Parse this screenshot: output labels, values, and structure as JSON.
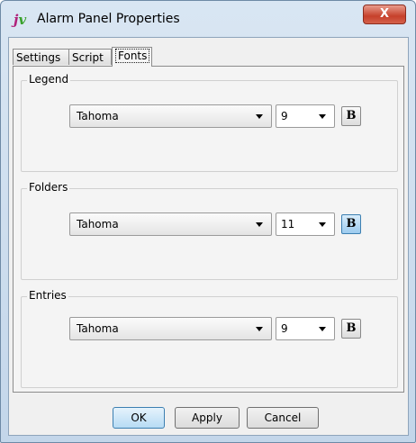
{
  "window": {
    "title": "Alarm Panel Properties",
    "close_label": "X"
  },
  "tabs": [
    {
      "label": "Settings",
      "active": false
    },
    {
      "label": "Script",
      "active": false
    },
    {
      "label": "Fonts",
      "active": true
    }
  ],
  "groups": {
    "legend": {
      "title": "Legend",
      "font": "Tahoma",
      "size": "9",
      "bold_label": "B",
      "bold_active": false
    },
    "folders": {
      "title": "Folders",
      "font": "Tahoma",
      "size": "11",
      "bold_label": "B",
      "bold_active": true
    },
    "entries": {
      "title": "Entries",
      "font": "Tahoma",
      "size": "9",
      "bold_label": "B",
      "bold_active": false
    }
  },
  "buttons": {
    "ok": "OK",
    "apply": "Apply",
    "cancel": "Cancel"
  },
  "colors": {
    "accent": "#3c7fb1",
    "close": "#c6402b"
  }
}
